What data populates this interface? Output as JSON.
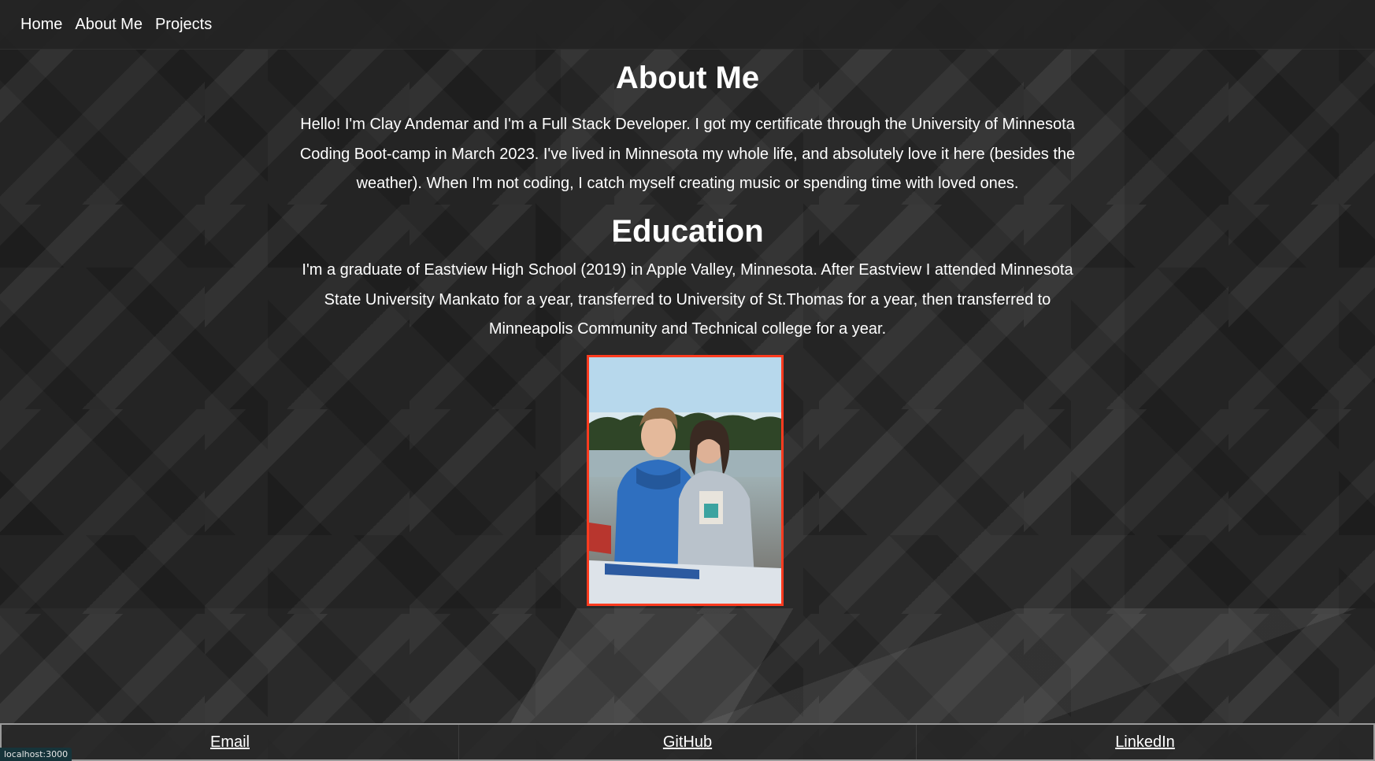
{
  "nav": {
    "links": [
      {
        "label": "Home"
      },
      {
        "label": "About Me"
      },
      {
        "label": "Projects"
      }
    ]
  },
  "about": {
    "heading": "About Me",
    "text": "Hello! I'm Clay Andemar and I'm a Full Stack Developer. I got my certificate through the University of Minnesota Coding Boot-camp in March 2023. I've lived in Minnesota my whole life, and absolutely love it here (besides the weather). When I'm not coding, I catch myself creating music or spending time with loved ones."
  },
  "education": {
    "heading": "Education",
    "text": "I'm a graduate of Eastview High School (2019) in Apple Valley, Minnesota. After Eastview I attended Minnesota State University Mankato for a year, transferred to University of St.Thomas for a year, then transferred to Minneapolis Community and Technical college for a year."
  },
  "footer": {
    "links": [
      {
        "label": "Email"
      },
      {
        "label": "GitHub"
      },
      {
        "label": "LinkedIn"
      }
    ]
  },
  "status_bar": {
    "url": "localhost:3000"
  },
  "colors": {
    "photo_border": "#ff3b1f",
    "background": "#2a2a2a",
    "text": "#ffffff",
    "status_bar_bg": "#16343a"
  }
}
